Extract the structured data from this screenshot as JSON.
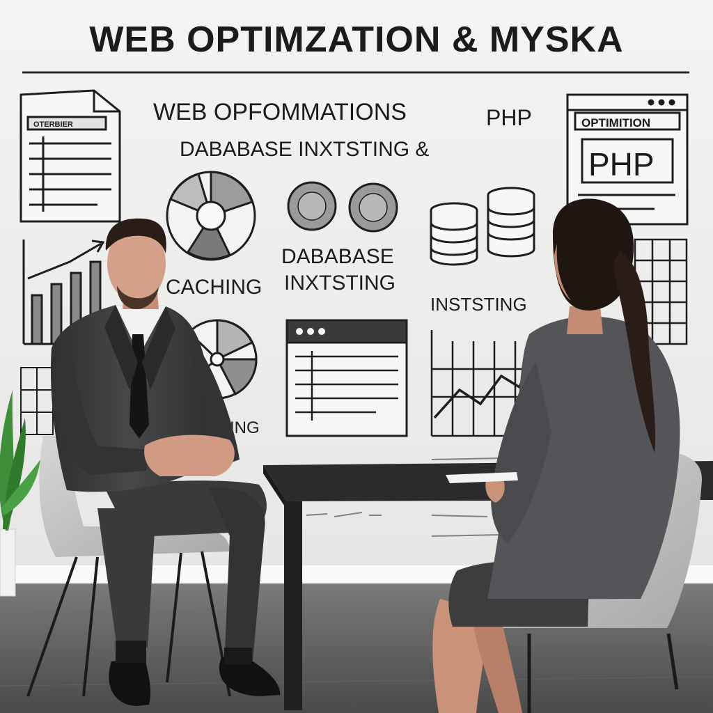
{
  "wall": {
    "headline": "WEB OPTIMZATION & MYSKA",
    "heading_1": "WEB OPFOMMATIONS",
    "heading_1_php": "PHP",
    "heading_2": "DABABASE INXTSTING &",
    "doc_label": "OTERBIER",
    "php_window_title": "OPTIMITION",
    "php_window_body": "PHP",
    "caching_label": "CACHING",
    "database_label_1": "DABABASE",
    "database_label_2": "INXTSTING",
    "indexing_label": "INSTSTING",
    "partial_label": "ING"
  },
  "colors": {
    "wall": "#efefee",
    "floor": "#5f5f5f",
    "suit": "#3a3a3c",
    "chair": "#c9c9c7",
    "table": "#2b2b2b",
    "plant": "#3f8e3a",
    "ink": "#1b1b1b"
  },
  "icons": [
    "document-icon",
    "pie-chart-icon",
    "disc-icon",
    "database-icon",
    "browser-window-icon",
    "bar-chart-icon",
    "line-chart-icon",
    "grid-icon"
  ]
}
